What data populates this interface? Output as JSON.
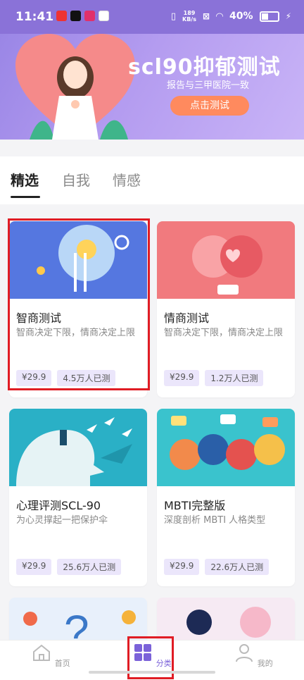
{
  "status_bar": {
    "time": "11:41",
    "net_speed_value": "189",
    "net_speed_unit": "KB/s",
    "battery": "40%"
  },
  "banner": {
    "title": "scl90抑郁测试",
    "subtitle": "报告与三甲医院一致",
    "button": "点击测试"
  },
  "tabs": [
    "精选",
    "自我",
    "情感"
  ],
  "cards": [
    {
      "title": "智商测试",
      "desc": "智商决定下限，情商决定上限",
      "price": "¥29.9",
      "count": "4.5万人已测",
      "color": "#5577e0"
    },
    {
      "title": "情商测试",
      "desc": "智商决定下限，情商决定上限",
      "price": "¥29.9",
      "count": "1.2万人已测",
      "color": "#f17a7e"
    },
    {
      "title": "心理评测SCL-90",
      "desc": "为心灵撑起一把保护伞",
      "price": "¥29.9",
      "count": "25.6万人已测",
      "color": "#2ab0c6"
    },
    {
      "title": "MBTI完整版",
      "desc": "深度剖析 MBTI 人格类型",
      "price": "¥29.9",
      "count": "22.6万人已测",
      "color": "#3ac3cd"
    }
  ],
  "bottom_nav": {
    "home": "首页",
    "category": "分类",
    "mine": "我的"
  },
  "colors": {
    "accent": "#7b62d9",
    "highlight": "#e01c24",
    "banner_button": "#ff8a5e"
  }
}
